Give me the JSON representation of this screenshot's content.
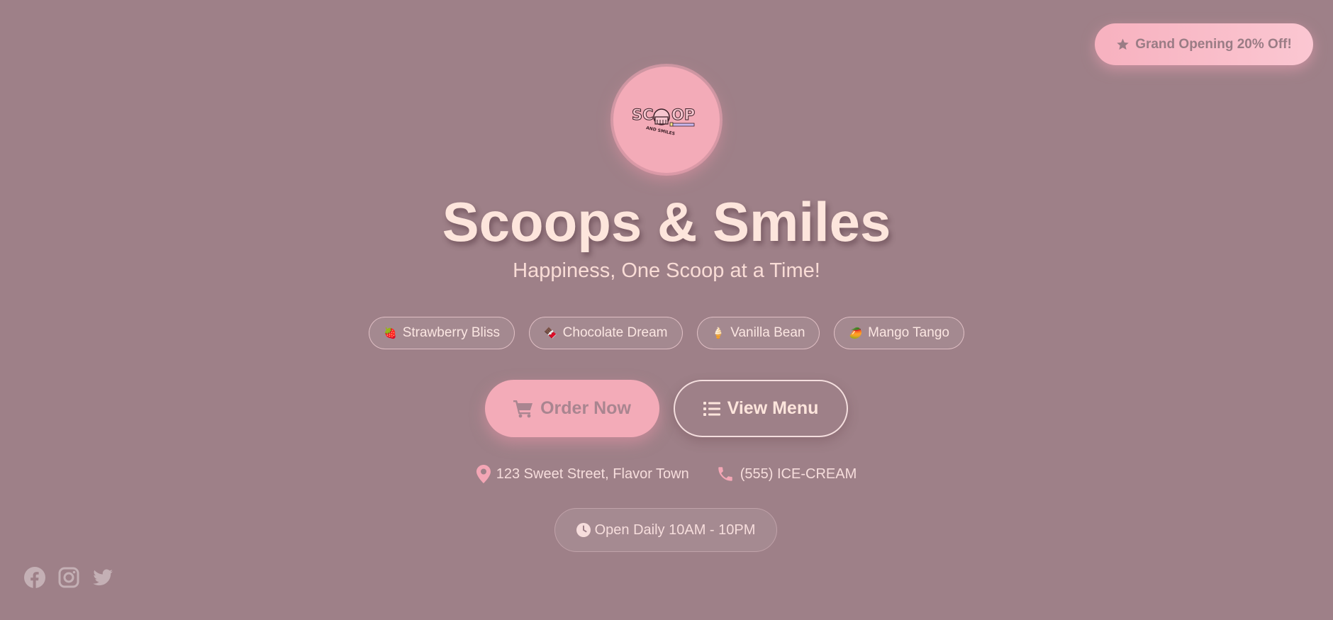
{
  "promo": {
    "label": "Grand Opening 20% Off!",
    "icon": "star-icon"
  },
  "logo": {
    "alt": "Scoop and Smiles logo"
  },
  "hero": {
    "title": "Scoops & Smiles",
    "tagline": "Happiness, One Scoop at a Time!"
  },
  "flavors": [
    {
      "emoji": "🍓",
      "label": "Strawberry Bliss"
    },
    {
      "emoji": "🍫",
      "label": "Chocolate Dream"
    },
    {
      "emoji": "🍦",
      "label": "Vanilla Bean"
    },
    {
      "emoji": "🥭",
      "label": "Mango Tango"
    }
  ],
  "actions": {
    "order_label": "Order Now",
    "order_icon": "cart-icon",
    "menu_label": "View Menu",
    "menu_icon": "list-icon"
  },
  "contact": {
    "address": "123 Sweet Street, Flavor Town",
    "phone": "(555) ICE-CREAM"
  },
  "hours": {
    "label": "Open Daily 10AM - 10PM"
  },
  "social": [
    {
      "name": "facebook-icon"
    },
    {
      "name": "instagram-icon"
    },
    {
      "name": "twitter-icon"
    }
  ],
  "colors": {
    "background": "#9e8088",
    "accent_pink": "#f3abb8",
    "title_cream": "#fde5dc"
  }
}
